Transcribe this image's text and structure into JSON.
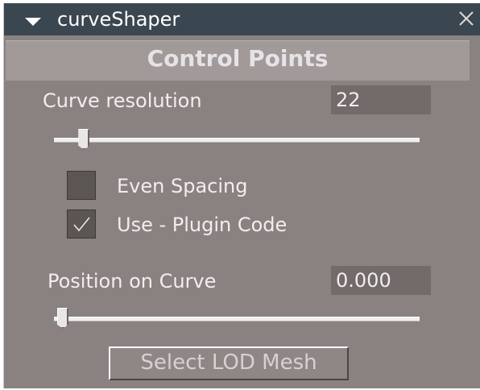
{
  "window": {
    "title": "curveShaper",
    "collapse_icon": "triangle-down-icon",
    "close_icon": "close-icon"
  },
  "section": {
    "title": "Control Points"
  },
  "curve_resolution": {
    "label": "Curve resolution",
    "value": "22",
    "slider_fraction": 0.06
  },
  "options": {
    "even_spacing": {
      "label": "Even Spacing",
      "checked": false
    },
    "use_plugin_code": {
      "label": "Use - Plugin Code",
      "checked": true
    }
  },
  "position_on_curve": {
    "label": "Position on Curve",
    "value": "0.000",
    "slider_fraction": 0.0
  },
  "select_button": {
    "label": "Select LOD Mesh"
  },
  "colors": {
    "titlebar": "#3b4750",
    "panel": "#8a8280",
    "section_header": "#a29a98",
    "field": "#726b6a"
  }
}
